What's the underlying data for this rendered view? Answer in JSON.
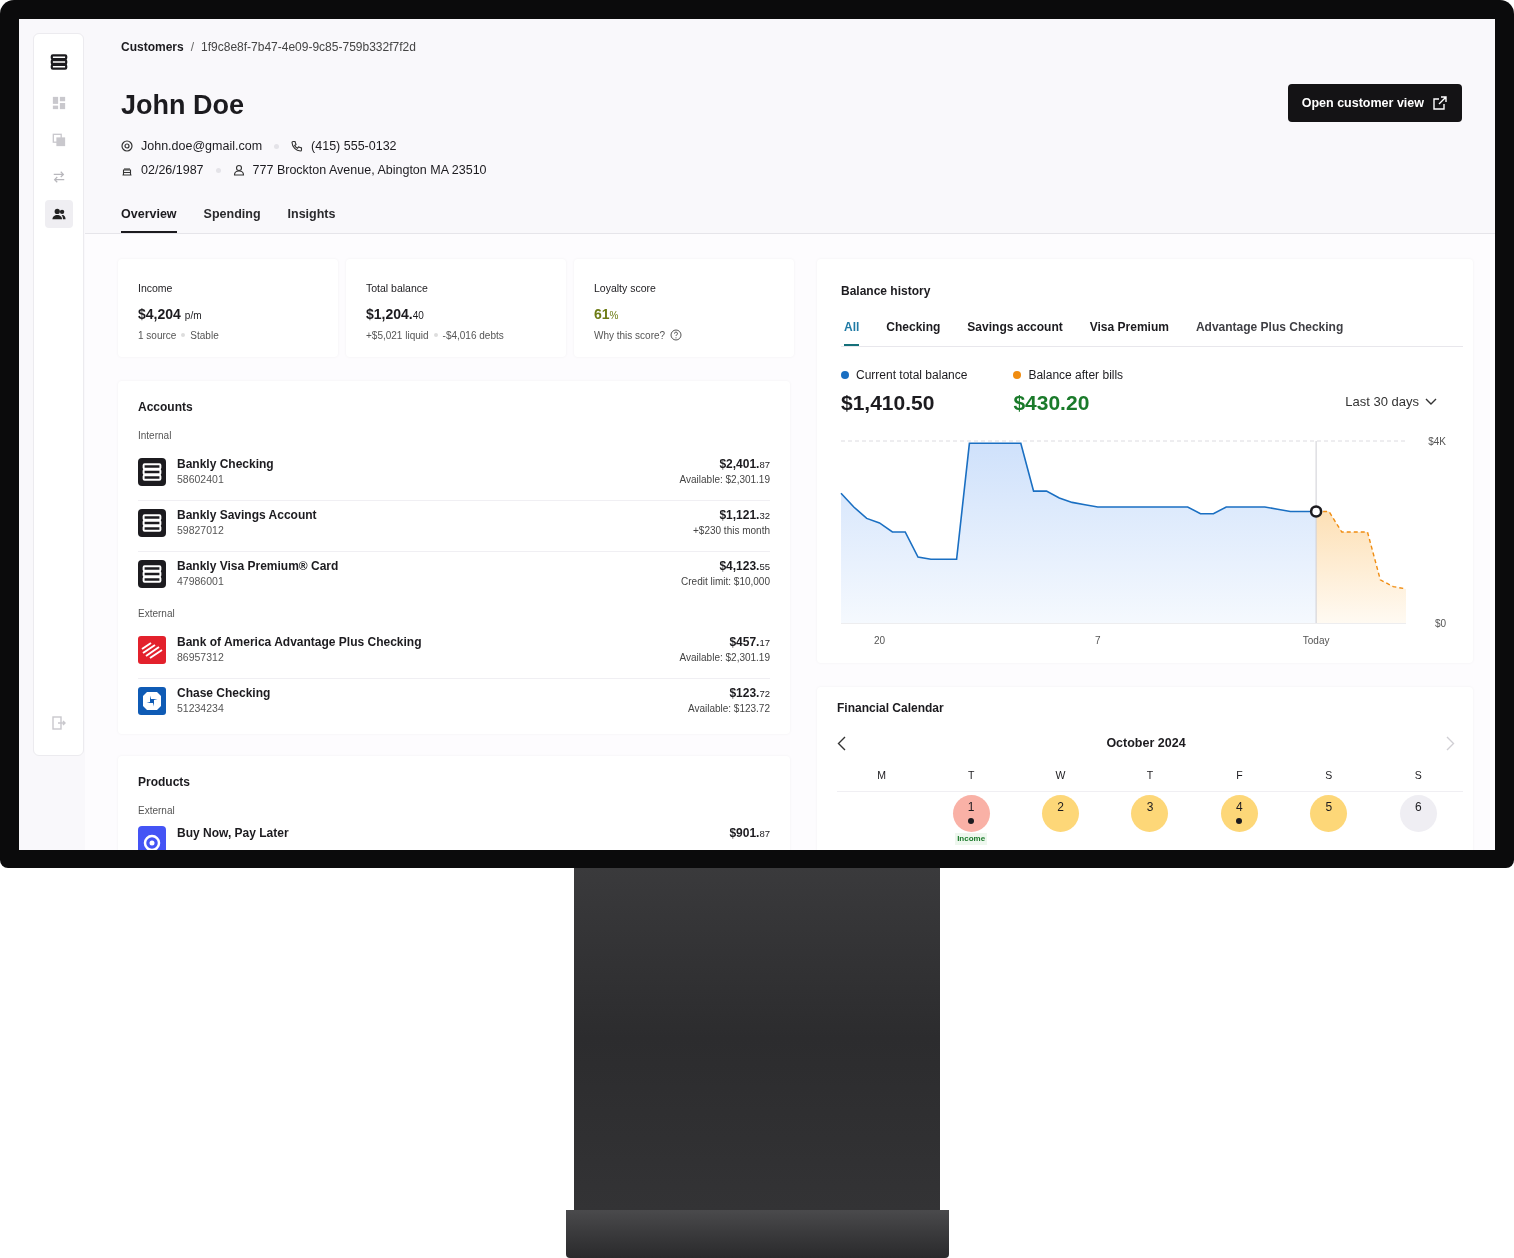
{
  "sidebar": {
    "items": [
      {
        "selected": false
      },
      {
        "selected": false
      },
      {
        "selected": false
      },
      {
        "selected": true
      }
    ]
  },
  "breadcrumb": {
    "parent": "Customers",
    "separator": "/",
    "current": "1f9c8e8f-7b47-4e09-9c85-759b332f7f2d"
  },
  "customer": {
    "name": "John Doe",
    "email": "John.doe@gmail.com",
    "phone": "(415) 555-0132",
    "birthdate": "02/26/1987",
    "address": "777 Brockton Avenue, Abington MA 23510"
  },
  "open_button": "Open customer view",
  "tabs": [
    {
      "label": "Overview",
      "selected": true
    },
    {
      "label": "Spending",
      "selected": false
    },
    {
      "label": "Insights",
      "selected": false
    }
  ],
  "stats": [
    {
      "label": "Income",
      "value": "$4,204",
      "suffix": "p/m",
      "notes": [
        "1 source",
        "Stable"
      ],
      "help": false
    },
    {
      "label": "Total balance",
      "value": "$1,204.",
      "suffix": "40",
      "notes": [
        "+$5,021 liquid",
        "-$4,016 debts"
      ],
      "help": false
    },
    {
      "label": "Loyalty score",
      "value": "61",
      "suffix": "%",
      "notes": [
        "Why this score?"
      ],
      "help": true
    }
  ],
  "accounts": {
    "title": "Accounts",
    "groups": [
      {
        "label": "Internal",
        "items": [
          {
            "kind": "bankly",
            "name": "Bankly Checking",
            "number": "58602401",
            "amount": "$2,401.",
            "cents": "87",
            "detail": "Available: $2,301.19"
          },
          {
            "kind": "bankly",
            "name": "Bankly Savings Account",
            "number": "59827012",
            "amount": "$1,121.",
            "cents": "32",
            "detail": "+$230 this month"
          },
          {
            "kind": "bankly",
            "name": "Bankly Visa Premium® Card",
            "number": "47986001",
            "amount": "$4,123.",
            "cents": "55",
            "detail": "Credit limit: $10,000"
          }
        ]
      },
      {
        "label": "External",
        "items": [
          {
            "kind": "stripes",
            "name": "Bank of America Advantage Plus Checking",
            "number": "86957312",
            "amount": "$457.",
            "cents": "17",
            "detail": "Available: $2,301.19"
          },
          {
            "kind": "octagon",
            "name": "Chase Checking",
            "number": "51234234",
            "amount": "$123.",
            "cents": "72",
            "detail": "Available: $123.72"
          }
        ]
      }
    ]
  },
  "products": {
    "title": "Products",
    "groups": [
      {
        "label": "External",
        "items": [
          {
            "kind": "circle",
            "name": "Buy Now, Pay Later",
            "amount": "$901.",
            "cents": "87"
          }
        ]
      }
    ]
  },
  "balance_history": {
    "title": "Balance history",
    "tabs": [
      {
        "label": "All",
        "selected": true
      },
      {
        "label": "Checking",
        "selected": false
      },
      {
        "label": "Savings account",
        "selected": false
      },
      {
        "label": "Visa Premium",
        "selected": false
      },
      {
        "label": "Advantage Plus Checking",
        "selected": false
      }
    ],
    "totals": [
      "$1,410.50",
      "$430.20"
    ],
    "range": "Last 30 days",
    "chart_data": {
      "type": "area",
      "categories": [
        null,
        null,
        null,
        "20",
        null,
        null,
        null,
        null,
        null,
        null,
        null,
        null,
        null,
        null,
        null,
        null,
        null,
        null,
        null,
        null,
        "7",
        null,
        null,
        null,
        null,
        null,
        null,
        null,
        null,
        null,
        null,
        null,
        null,
        null,
        null,
        null,
        null,
        "Today",
        null,
        null,
        null,
        null,
        null,
        null,
        null
      ],
      "series": [
        {
          "name": "Current total balance",
          "color": "#1a6fc2",
          "values": [
            2850,
            2550,
            2300,
            2200,
            2000,
            2000,
            1450,
            1400,
            1400,
            1400,
            3950,
            3950,
            3950,
            3950,
            3950,
            2900,
            2900,
            2750,
            2650,
            2600,
            2550,
            2550,
            2550,
            2550,
            2550,
            2550,
            2550,
            2550,
            2400,
            2400,
            2550,
            2550,
            2550,
            2550,
            2500,
            2450,
            2450,
            2450,
            null,
            null,
            null,
            null,
            null,
            null,
            null
          ]
        },
        {
          "name": "Balance after bills",
          "color": "#f08c10",
          "values": [
            null,
            null,
            null,
            null,
            null,
            null,
            null,
            null,
            null,
            null,
            null,
            null,
            null,
            null,
            null,
            null,
            null,
            null,
            null,
            null,
            null,
            null,
            null,
            null,
            null,
            null,
            null,
            null,
            null,
            null,
            null,
            null,
            null,
            null,
            null,
            null,
            null,
            2450,
            2450,
            2000,
            2000,
            2000,
            950,
            800,
            750
          ]
        }
      ],
      "ylim": [
        0,
        4000
      ],
      "yticks": [
        {
          "value": 0,
          "label": "$0"
        },
        {
          "value": 4000,
          "label": "$4K"
        }
      ]
    }
  },
  "calendar": {
    "title": "Financial Calendar",
    "month": "October 2024",
    "weekdays": [
      "M",
      "T",
      "W",
      "T",
      "F",
      "S",
      "S"
    ],
    "days": [
      {
        "date": "1",
        "color": "#f9b1a6",
        "dot": true,
        "label": "Income"
      },
      {
        "date": "2",
        "color": "#fdd778",
        "dot": false
      },
      {
        "date": "3",
        "color": "#fdd778",
        "dot": false
      },
      {
        "date": "4",
        "color": "#fdd778",
        "dot": true
      },
      {
        "date": "5",
        "color": "#fdd778",
        "dot": false
      },
      {
        "date": "6",
        "color": "#efeef3",
        "dot": false
      }
    ]
  }
}
